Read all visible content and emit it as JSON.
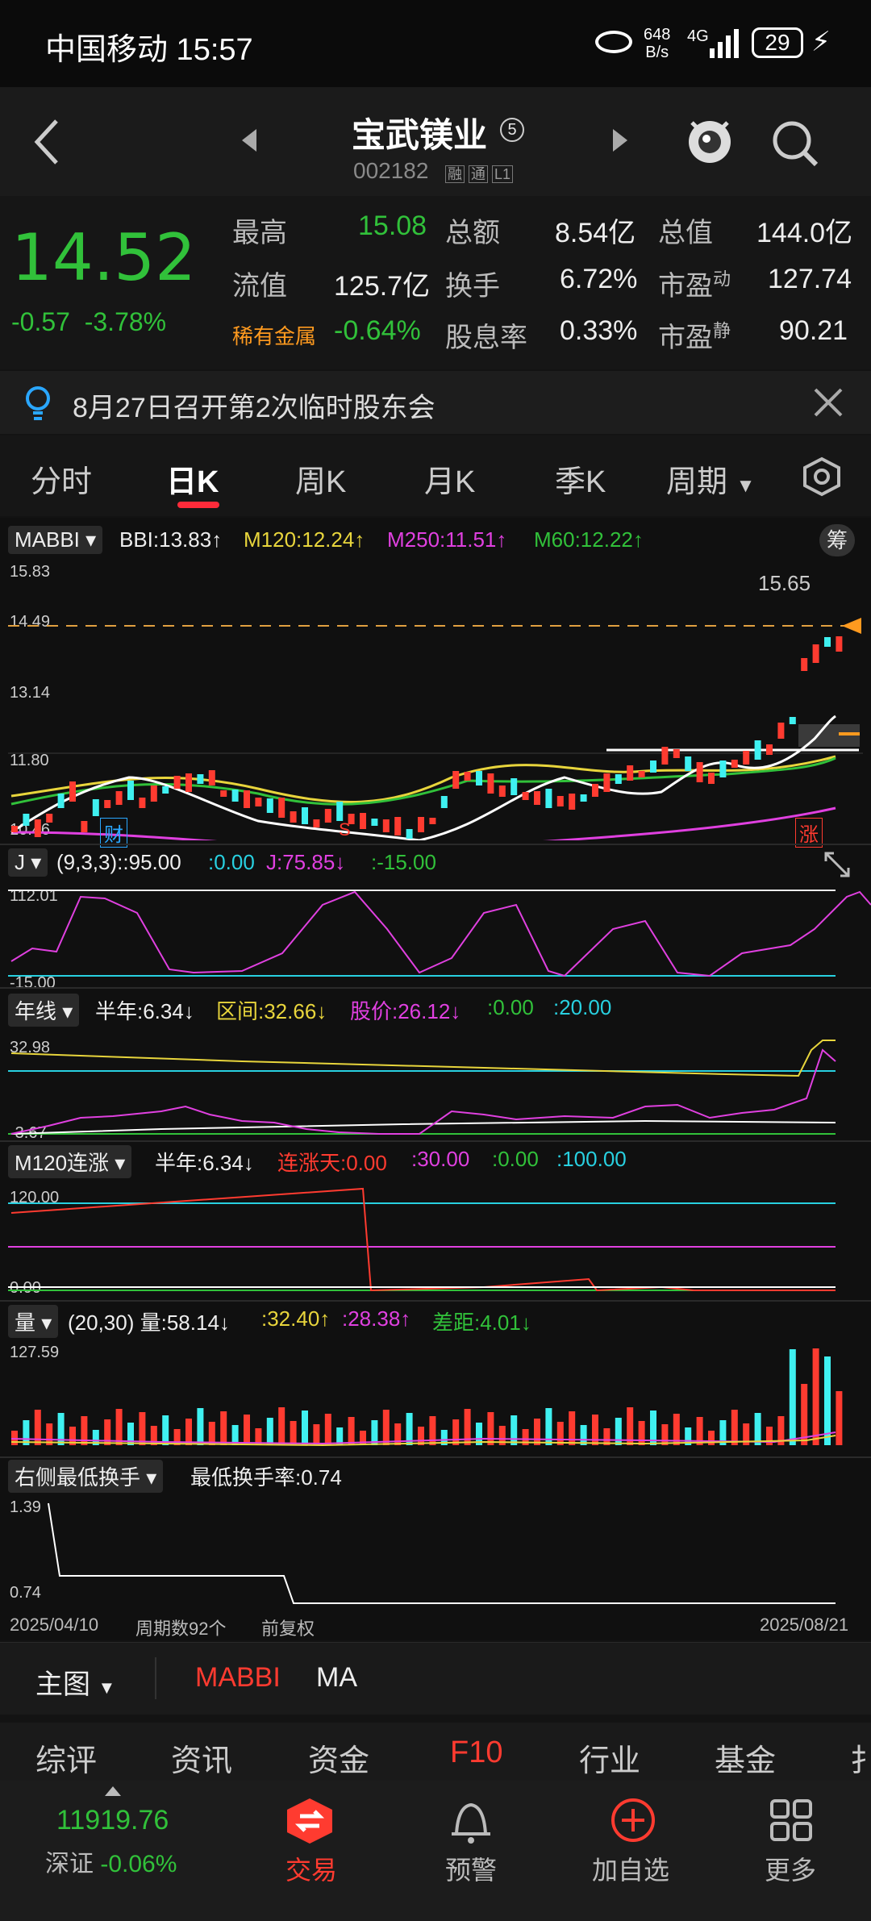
{
  "status": {
    "carrier_time": "中国移动 15:57",
    "net_speed": "648",
    "net_unit": "B/s",
    "net_type": "4G",
    "battery": "29"
  },
  "nav": {
    "title": "宝武镁业",
    "badge": "5",
    "code": "002182",
    "tags": [
      "融",
      "通",
      "L1"
    ]
  },
  "quote": {
    "price": "14.52",
    "change": "-0.57",
    "pct": "-3.78%",
    "r1": [
      {
        "k": "最高",
        "v": "15.08"
      },
      {
        "k": "总额",
        "v": "8.54亿"
      },
      {
        "k": "总值",
        "v": "144.0亿"
      }
    ],
    "r2": [
      {
        "k": "流值",
        "v": "125.7亿"
      },
      {
        "k": "换手",
        "v": "6.72%"
      },
      {
        "k": "市盈",
        "sup": "动",
        "v": "127.74"
      }
    ],
    "r3": [
      {
        "k": "稀有金属",
        "v": "-0.64%"
      },
      {
        "k": "股息率",
        "v": "0.33%"
      },
      {
        "k": "市盈",
        "sup": "静",
        "v": "90.21"
      }
    ]
  },
  "notice": {
    "text": "8月27日召开第2次临时股东会"
  },
  "tabs": {
    "items": [
      "分时",
      "日K",
      "周K",
      "月K",
      "季K",
      "周期"
    ],
    "active": "日K"
  },
  "main": {
    "indicator": "MABBI",
    "bbi": "BBI:13.83↑",
    "m120": "M120:12.24↑",
    "m250": "M250:11.51↑",
    "m60": "M60:12.22↑",
    "chip": "筹",
    "y_labels": [
      "15.83",
      "14.49",
      "13.14",
      "11.80",
      "10.46"
    ],
    "max_label": "15.65",
    "event_cai": "财",
    "event_s": "S",
    "event_zhang": "涨"
  },
  "kdj": {
    "name": "J",
    "params": "(9,3,3)",
    "v95": ":95.00",
    ":0": ":0.00",
    "j": "J:75.85↓",
    "neg": ":-15.00",
    "top": "112.01",
    "bottom": "-15.00"
  },
  "year": {
    "name": "年线",
    "half": "半年:6.34↓",
    "range": "区间:32.66↓",
    "price": "股价:26.12↓",
    "zero": ":0.00",
    "twenty": ":20.00",
    "top": "32.98",
    "bottom": "-3.67"
  },
  "m120lz": {
    "name": "M120连涨",
    "half": "半年:6.34↓",
    "days": "连涨天:0.00",
    "thirty": ":30.00",
    "zero": ":0.00",
    "hundred": ":100.00",
    "top": "120.00",
    "bottom": "0.00"
  },
  "vol": {
    "name": "量",
    "params": "(20,30)",
    "v": "量:58.14↓",
    "a": ":32.40↑",
    "b": ":28.38↑",
    "diff": "差距:4.01↓",
    "top": "127.59"
  },
  "turnover": {
    "name": "右侧最低换手",
    "value": "最低换手率:0.74",
    "top": "1.39",
    "bottom": "0.74"
  },
  "footer": {
    "start": "2025/04/10",
    "count": "周期数92个",
    "adj": "前复权",
    "end": "2025/08/21"
  },
  "bottom": {
    "main": "主图",
    "ind1": "MABBI",
    "ind2": "MA"
  },
  "f10": [
    "综评",
    "资讯",
    "资金",
    "F10",
    "行业",
    "基金",
    "扌"
  ],
  "dock": {
    "index_val": "11919.76",
    "index_name": "深证",
    "index_pct": "-0.06%",
    "trade": "交易",
    "alert": "预警",
    "add": "加自选",
    "more": "更多"
  }
}
